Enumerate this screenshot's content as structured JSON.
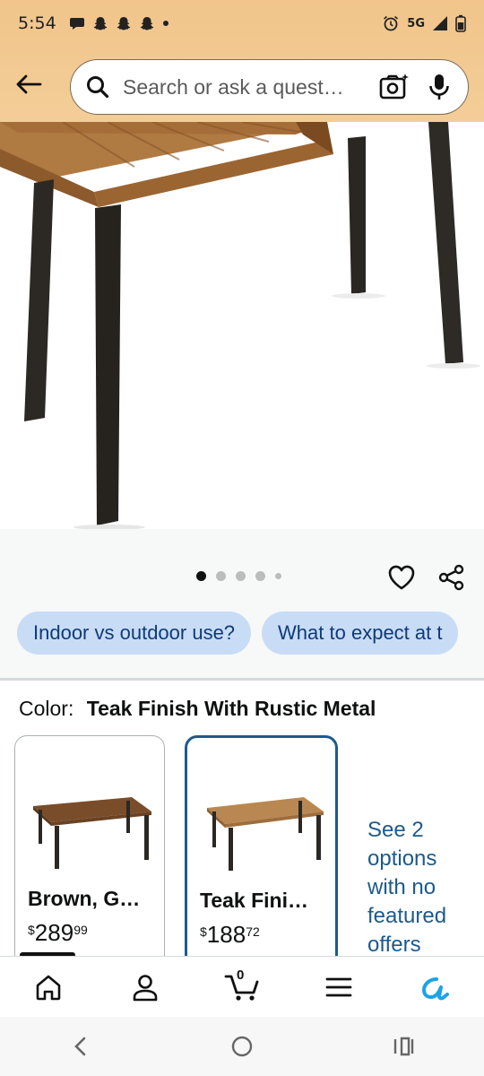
{
  "status_bar": {
    "time": "5:54",
    "network": "5G",
    "left_icons": [
      "chat-bubble-icon",
      "snapchat-icon",
      "snapchat-icon",
      "snapchat-icon",
      "dot-icon"
    ],
    "right_icons": [
      "alarm-icon",
      "signal-icon",
      "battery-icon"
    ]
  },
  "header": {
    "back_icon": "back-arrow-icon",
    "search": {
      "placeholder": "Search or ask a quest…",
      "search_icon": "search-icon",
      "camera_icon": "camera-sparkle-icon",
      "mic_icon": "microphone-icon"
    }
  },
  "gallery": {
    "image_subject": "outdoor dining table, teak wood top, rustic metal legs",
    "page_indicator": {
      "count": 5,
      "active_index": 0
    },
    "actions": [
      "heart-icon",
      "share-icon"
    ]
  },
  "question_chips": [
    "Indoor vs outdoor use?",
    "What to expect at t"
  ],
  "color_section": {
    "label": "Color:",
    "selected_value": "Teak Finish With Rustic Metal",
    "options": [
      {
        "name": "Brown, G…",
        "price_symbol": "$",
        "price_whole": "289",
        "price_fraction": "99",
        "selected": false
      },
      {
        "name": "Teak Fini…",
        "price_symbol": "$",
        "price_whole": "188",
        "price_fraction": "72",
        "selected": true
      }
    ],
    "more_options_text": "See 2 options with no featured offers"
  },
  "bottom_nav": {
    "items": [
      "home-icon",
      "account-icon",
      "cart-icon",
      "menu-icon",
      "rufus-icon"
    ],
    "cart_count": "0",
    "active_index": 0
  },
  "system_nav": [
    "back-chevron-icon",
    "home-circle-icon",
    "recents-icon"
  ],
  "colors": {
    "header_bg": "#f3cd98",
    "chip_bg": "#c8dcf6",
    "chip_text": "#0f3a78",
    "selected_border": "#1c5a8c",
    "link": "#1c5a8c",
    "rufus_accent": "#1aa3e8"
  }
}
